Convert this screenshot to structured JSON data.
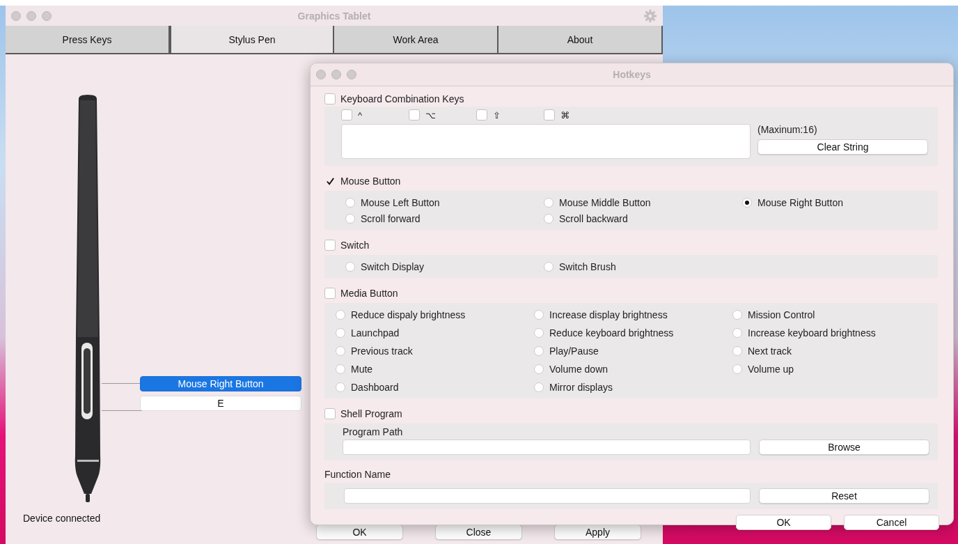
{
  "window": {
    "title": "Graphics Tablet",
    "tabs": [
      {
        "label": "Press Keys",
        "selected": false
      },
      {
        "label": "Stylus Pen",
        "selected": true
      },
      {
        "label": "Work Area",
        "selected": false
      },
      {
        "label": "About",
        "selected": false
      }
    ],
    "pen_buttons": [
      {
        "label": "Mouse Right Button",
        "selected": true
      },
      {
        "label": "E",
        "selected": false
      }
    ],
    "status": "Device connected",
    "buttons": [
      "OK",
      "Close",
      "Apply"
    ]
  },
  "dialog": {
    "title": "Hotkeys",
    "keyboard": {
      "label": "Keyboard Combination Keys",
      "checked": false,
      "modifiers": [
        {
          "symbol": "^",
          "checked": false
        },
        {
          "symbol": "⌥",
          "checked": false
        },
        {
          "symbol": "⇧",
          "checked": false
        },
        {
          "symbol": "⌘",
          "checked": false
        }
      ],
      "note": "(Maxinum:16)",
      "button": "Clear String"
    },
    "radio_groups": [
      {
        "label": "Mouse Button",
        "checked": true,
        "options": [
          {
            "label": "Mouse Left Button",
            "selected": false
          },
          {
            "label": "Mouse Middle Button",
            "selected": false
          },
          {
            "label": "Mouse Right Button",
            "selected": true
          },
          {
            "label": "Scroll forward",
            "selected": false
          },
          {
            "label": "Scroll backward",
            "selected": false
          }
        ]
      },
      {
        "label": "Switch",
        "checked": false,
        "options": [
          {
            "label": "Switch Display",
            "selected": false
          },
          {
            "label": "Switch Brush",
            "selected": false
          }
        ]
      },
      {
        "label": "Media Button",
        "checked": false,
        "options": [
          {
            "label": "Reduce dispaly brightness",
            "selected": false
          },
          {
            "label": "Increase display brightness",
            "selected": false
          },
          {
            "label": "Mission Control",
            "selected": false
          },
          {
            "label": "Launchpad",
            "selected": false
          },
          {
            "label": "Reduce keyboard brightness",
            "selected": false
          },
          {
            "label": "Increase keyboard brightness",
            "selected": false
          },
          {
            "label": "Previous track",
            "selected": false
          },
          {
            "label": "Play/Pause",
            "selected": false
          },
          {
            "label": "Next track",
            "selected": false
          },
          {
            "label": "Mute",
            "selected": false
          },
          {
            "label": "Volume down",
            "selected": false
          },
          {
            "label": "Volume up",
            "selected": false
          },
          {
            "label": "Dashboard",
            "selected": false
          },
          {
            "label": "Mirror displays",
            "selected": false
          }
        ]
      }
    ],
    "shell": {
      "label": "Shell Program",
      "checked": false,
      "path_label": "Program Path",
      "button": "Browse"
    },
    "function_name": {
      "label": "Function Name",
      "button": "Reset"
    },
    "buttons": [
      "OK",
      "Cancel"
    ]
  }
}
